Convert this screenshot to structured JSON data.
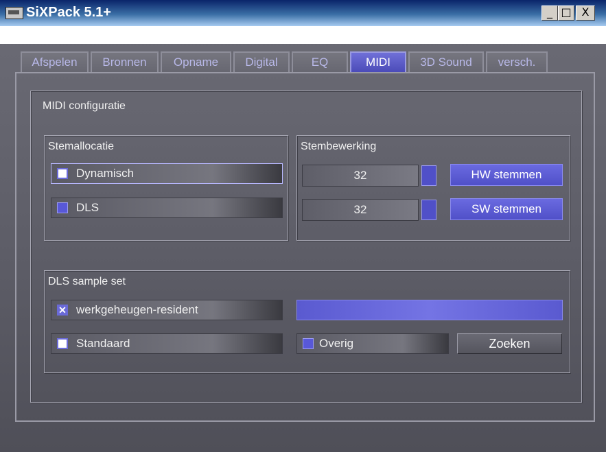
{
  "window": {
    "title": "SiXPack 5.1+"
  },
  "controls": {
    "minimize": "_",
    "maximize": "□",
    "close": "X"
  },
  "tabs": [
    {
      "label": "Afspelen"
    },
    {
      "label": "Bronnen"
    },
    {
      "label": "Opname"
    },
    {
      "label": "Digital"
    },
    {
      "label": "EQ"
    },
    {
      "label": "MIDI"
    },
    {
      "label": "3D Sound"
    },
    {
      "label": "versch."
    }
  ],
  "midi": {
    "title": "MIDI configuratie",
    "stemallocatie": {
      "title": "Stemallocatie",
      "dynamisch": "Dynamisch",
      "dls": "DLS"
    },
    "stembewerking": {
      "title": "Stembewerking",
      "hw_value": "32",
      "sw_value": "32",
      "hw_button": "HW stemmen",
      "sw_button": "SW stemmen"
    },
    "dls_sample_set": {
      "title": "DLS sample set",
      "werkgeheugen": "werkgeheugen-resident",
      "standaard": "Standaard",
      "overig": "Overig",
      "zoeken": "Zoeken"
    }
  },
  "colors": {
    "accent": "#5050c8",
    "active_tab": "#5858c8",
    "panel": "#64646e"
  }
}
